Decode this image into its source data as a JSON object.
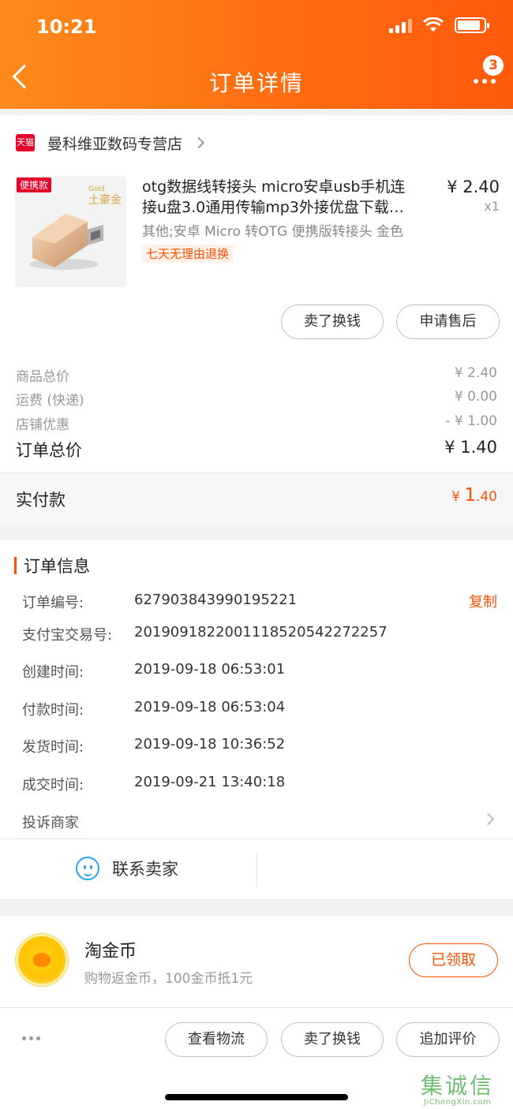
{
  "status_bar": {
    "time": "10:21"
  },
  "header": {
    "title": "订单详情",
    "badge_count": "3"
  },
  "shop": {
    "badge": "天猫",
    "name": "曼科维亚数码专营店"
  },
  "product": {
    "tag": "便携款",
    "gold_small": "Gold",
    "gold_label": "土豪金",
    "title_line1": "otg数据线转接头 micro安卓usb手机连",
    "title_line2": "接u盘3.0通用传输mp3外接优盘下载…",
    "spec": "其他;安卓 Micro 转OTG 便携版转接头 金色",
    "return_tag": "七天无理由退换",
    "price": "¥ 2.40",
    "qty": "x1"
  },
  "item_actions": {
    "sell": "卖了换钱",
    "after_sale": "申请售后"
  },
  "summary": {
    "rows": [
      {
        "label": "商品总价",
        "value": "¥ 2.40"
      },
      {
        "label": "运费 (快递)",
        "value": "¥ 0.00"
      },
      {
        "label": "店铺优惠",
        "value": "- ¥ 1.00"
      }
    ],
    "total_label": "订单总价",
    "total_value": "¥ 1.40",
    "paid_label": "实付款",
    "paid_currency": "¥ ",
    "paid_int": "1",
    "paid_dec": ".40"
  },
  "order_info": {
    "heading": "订单信息",
    "copy": "复制",
    "rows": [
      {
        "label": "订单编号:",
        "value": "627903843990195221"
      },
      {
        "label": "支付宝交易号:",
        "value": "2019091822001118520542272257"
      },
      {
        "label": "创建时间:",
        "value": "2019-09-18 06:53:01"
      },
      {
        "label": "付款时间:",
        "value": "2019-09-18 06:53:04"
      },
      {
        "label": "发货时间:",
        "value": "2019-09-18 10:36:52"
      },
      {
        "label": "成交时间:",
        "value": "2019-09-21 13:40:18"
      }
    ],
    "complain": "投诉商家",
    "contact": "联系卖家"
  },
  "coins": {
    "title": "淘金币",
    "subtitle": "购物返金币，100金币抵1元",
    "button": "已领取"
  },
  "bottom": {
    "logistics": "查看物流",
    "sell": "卖了换钱",
    "review": "追加评价"
  },
  "watermark": {
    "big": "集诚信",
    "small": "JiChengXin.com"
  },
  "colors": {
    "accent": "#ff5000",
    "header_start": "#ff8a1a",
    "header_end": "#ff5a0c"
  }
}
